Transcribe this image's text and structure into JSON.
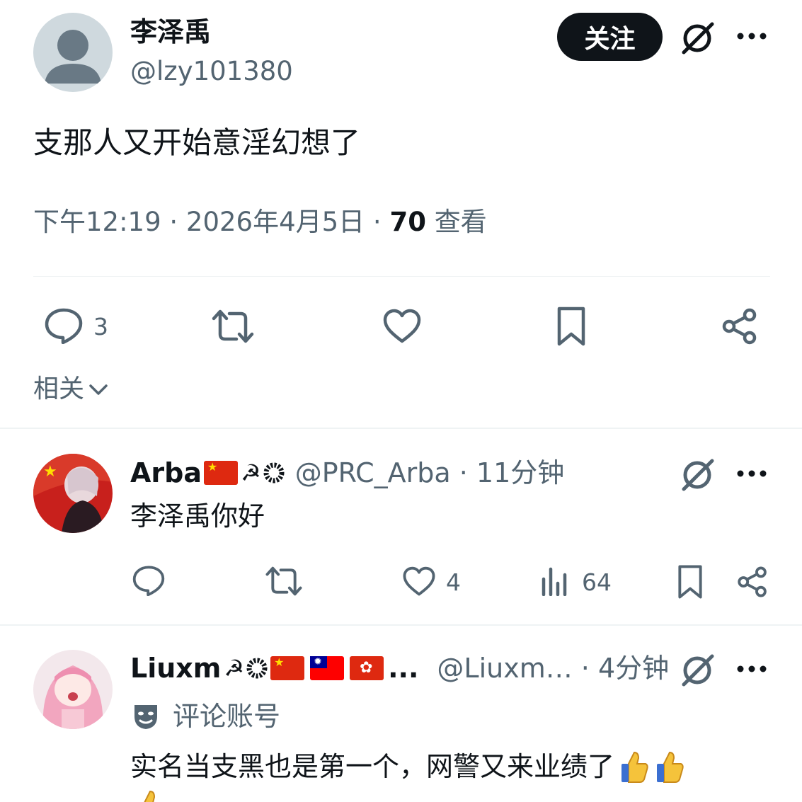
{
  "post": {
    "author_name": "李泽禹",
    "author_handle": "@lzy101380",
    "follow_label": "关注",
    "text": "支那人又开始意淫幻想了",
    "time": "下午12:19 · 2026年4月5日 · ",
    "views_count": "70",
    "views_label": " 查看",
    "reply_count": "3",
    "related_label": "相关"
  },
  "replies": [
    {
      "name": "Arba",
      "handle": "@PRC_Arba · 11分钟",
      "text": "李泽禹你好",
      "like_count": "4",
      "view_count": "64"
    },
    {
      "name": "Liuxm",
      "ellipsis": "...",
      "handle": "@Liuxm… · 4分钟",
      "community_label": "评论账号",
      "text": "实名当支黑也是第一个，网警又来业绩了"
    }
  ],
  "colors": {
    "text": "#0f1419",
    "muted": "#536471",
    "divider": "#eff3f4",
    "button_bg": "#0f1419"
  }
}
